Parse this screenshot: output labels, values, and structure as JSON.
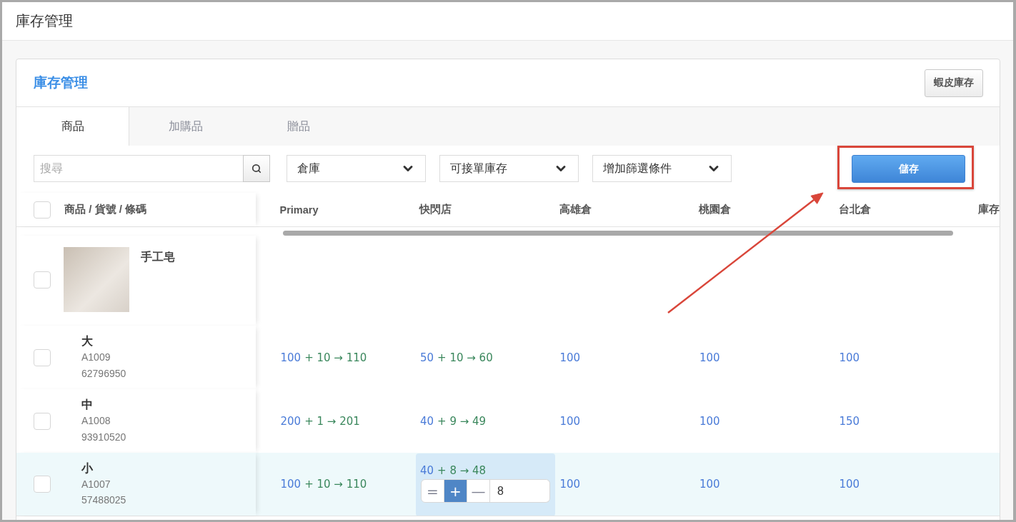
{
  "page": {
    "title": "庫存管理"
  },
  "card": {
    "title": "庫存管理",
    "action_button": "蝦皮庫存"
  },
  "tabs": [
    {
      "label": "商品",
      "selected": true
    },
    {
      "label": "加購品",
      "selected": false
    },
    {
      "label": "贈品",
      "selected": false
    }
  ],
  "toolbar": {
    "search": {
      "placeholder": "搜尋"
    },
    "dropdowns": [
      {
        "label": "倉庫"
      },
      {
        "label": "可接單庫存"
      },
      {
        "label": "增加篩選條件"
      }
    ],
    "save_button": {
      "label": "儲存",
      "annotated": true
    }
  },
  "table": {
    "select_all": {
      "checked": false
    },
    "product_column": "商品 / 貨號 / 條碼",
    "columns": [
      "Primary",
      "快閃店",
      "高雄倉",
      "桃園倉",
      "台北倉",
      "庫存"
    ],
    "product": {
      "name": "手工皂",
      "checked": false
    },
    "rows": [
      {
        "name": "大",
        "sku": "A1009",
        "barcode": "62796950",
        "checked": false,
        "highlighted": false,
        "cells": [
          {
            "kind": "change",
            "base": "100",
            "change": "+ 10 → 110"
          },
          {
            "kind": "change",
            "base": "50",
            "change": "+ 10 → 60"
          },
          {
            "kind": "value",
            "value": "100"
          },
          {
            "kind": "value",
            "value": "100"
          },
          {
            "kind": "value",
            "value": "100"
          }
        ]
      },
      {
        "name": "中",
        "sku": "A1008",
        "barcode": "93910520",
        "checked": false,
        "highlighted": false,
        "cells": [
          {
            "kind": "change",
            "base": "200",
            "change": "+ 1 → 201"
          },
          {
            "kind": "change",
            "base": "40",
            "change": "+ 9 → 49"
          },
          {
            "kind": "value",
            "value": "100"
          },
          {
            "kind": "value",
            "value": "100"
          },
          {
            "kind": "value",
            "value": "150"
          }
        ]
      },
      {
        "name": "小",
        "sku": "A1007",
        "barcode": "57488025",
        "checked": false,
        "highlighted": true,
        "cells": [
          {
            "kind": "change",
            "base": "100",
            "change": "+ 10 → 110"
          },
          {
            "kind": "edit",
            "base": "40",
            "change": "+ 8 → 48",
            "modes": [
              {
                "symbol": "=",
                "selected": false
              },
              {
                "symbol": "+",
                "selected": true
              },
              {
                "symbol": "—",
                "selected": false
              }
            ],
            "amount": "8"
          },
          {
            "kind": "value",
            "value": "100"
          },
          {
            "kind": "value",
            "value": "100"
          },
          {
            "kind": "value",
            "value": "100"
          }
        ]
      }
    ]
  }
}
